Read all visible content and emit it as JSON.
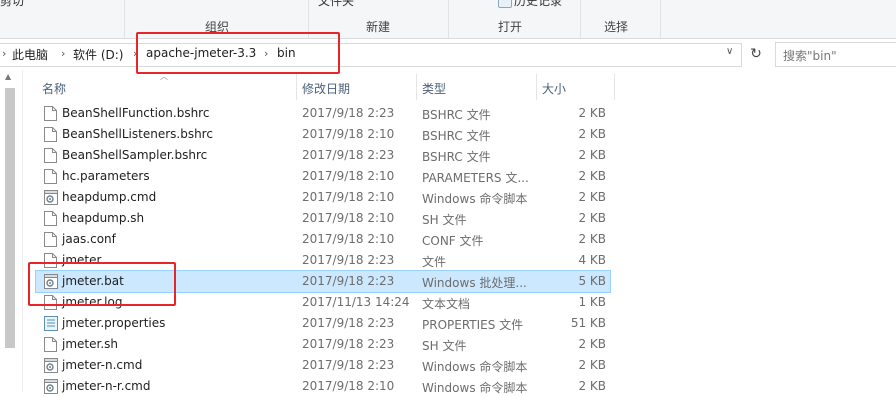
{
  "ribbon": {
    "top_labels": [
      "剪切",
      "文件夹",
      "历史记录"
    ],
    "groups": [
      "组织",
      "新建",
      "打开",
      "选择"
    ]
  },
  "address": {
    "crumbs": [
      "此电脑",
      "软件 (D:)",
      "apache-jmeter-3.3",
      "bin"
    ],
    "search_placeholder": "搜索\"bin\""
  },
  "columns": {
    "name": "名称",
    "date": "修改日期",
    "type": "类型",
    "size": "大小"
  },
  "files": [
    {
      "name": "BeanShellFunction.bshrc",
      "date": "2017/9/18 2:23",
      "type": "BSHRC 文件",
      "size": "2 KB",
      "icon": "document-icon"
    },
    {
      "name": "BeanShellListeners.bshrc",
      "date": "2017/9/18 2:10",
      "type": "BSHRC 文件",
      "size": "2 KB",
      "icon": "document-icon"
    },
    {
      "name": "BeanShellSampler.bshrc",
      "date": "2017/9/18 2:23",
      "type": "BSHRC 文件",
      "size": "2 KB",
      "icon": "document-icon"
    },
    {
      "name": "hc.parameters",
      "date": "2017/9/18 2:10",
      "type": "PARAMETERS 文...",
      "size": "2 KB",
      "icon": "document-icon"
    },
    {
      "name": "heapdump.cmd",
      "date": "2017/9/18 2:10",
      "type": "Windows 命令脚本",
      "size": "2 KB",
      "icon": "script-gear-icon"
    },
    {
      "name": "heapdump.sh",
      "date": "2017/9/18 2:10",
      "type": "SH 文件",
      "size": "2 KB",
      "icon": "document-icon"
    },
    {
      "name": "jaas.conf",
      "date": "2017/9/18 2:10",
      "type": "CONF 文件",
      "size": "2 KB",
      "icon": "document-icon"
    },
    {
      "name": "jmeter",
      "date": "2017/9/18 2:23",
      "type": "文件",
      "size": "4 KB",
      "icon": "document-icon"
    },
    {
      "name": "jmeter.bat",
      "date": "2017/9/18 2:23",
      "type": "Windows 批处理...",
      "size": "5 KB",
      "icon": "script-gear-icon",
      "selected": true
    },
    {
      "name": "jmeter.log",
      "date": "2017/11/13 14:24",
      "type": "文本文档",
      "size": "1 KB",
      "icon": "document-icon"
    },
    {
      "name": "jmeter.properties",
      "date": "2017/9/18 2:23",
      "type": "PROPERTIES 文件",
      "size": "51 KB",
      "icon": "properties-icon"
    },
    {
      "name": "jmeter.sh",
      "date": "2017/9/18 2:23",
      "type": "SH 文件",
      "size": "2 KB",
      "icon": "document-icon"
    },
    {
      "name": "jmeter-n.cmd",
      "date": "2017/9/18 2:23",
      "type": "Windows 命令脚本",
      "size": "2 KB",
      "icon": "script-gear-icon"
    },
    {
      "name": "jmeter-n-r.cmd",
      "date": "2017/9/18 2:10",
      "type": "Windows 命令脚本",
      "size": "2 KB",
      "icon": "script-gear-icon"
    }
  ],
  "colors": {
    "selection": "#cce8ff",
    "highlight_box": "#e8262a"
  }
}
